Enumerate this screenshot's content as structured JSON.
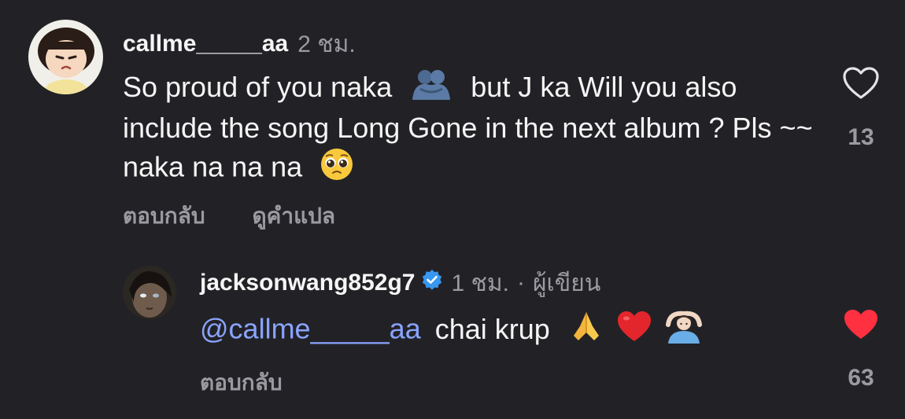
{
  "comments": [
    {
      "username": "callme_____aa",
      "time": "2 ชม.",
      "text_a": "So proud of you naka",
      "text_b": "but J ka Will you also include the song Long Gone in the next album ? Pls ~~ naka na na na",
      "reply_label": "ตอบกลับ",
      "translate_label": "ดูคำแปล",
      "likes": "13",
      "liked": false,
      "emojis": [
        "hugging-people-emoji",
        "pleading-face-emoji"
      ]
    },
    {
      "username": "jacksonwang852g7",
      "time": "1 ชม.",
      "dot": "·",
      "author_label": "ผู้เขียน",
      "verified": true,
      "mention": "@callme_____aa",
      "text": "chai krup",
      "reply_label": "ตอบกลับ",
      "likes": "63",
      "liked": true,
      "emojis": [
        "folded-hands-emoji",
        "red-heart-emoji",
        "person-gesturing-ok-emoji"
      ]
    }
  ],
  "colors": {
    "background": "#222226",
    "text": "#f5f5f5",
    "muted": "#9a9aa0",
    "mention": "#8aa4ff",
    "verified": "#3897f0",
    "liked_heart": "#ff3040"
  }
}
